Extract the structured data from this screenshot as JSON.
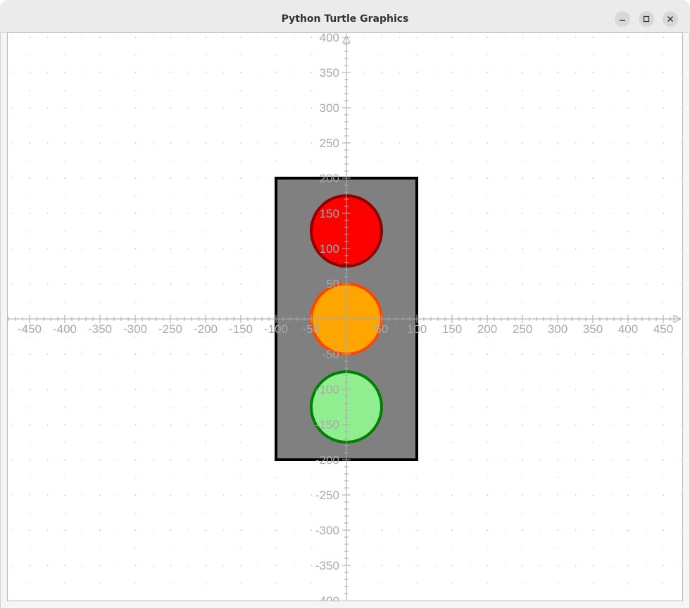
{
  "window": {
    "title": "Python Turtle Graphics"
  },
  "axes": {
    "x_ticks": [
      -450,
      -400,
      -350,
      -300,
      -250,
      -200,
      -150,
      -100,
      -50,
      50,
      100,
      150,
      200,
      250,
      300,
      350,
      400,
      450
    ],
    "y_ticks": [
      400,
      350,
      300,
      250,
      200,
      150,
      100,
      50,
      -50,
      -100,
      -150,
      -200,
      -250,
      -300,
      -350,
      -400
    ],
    "grid": "dotted",
    "color": "#a9a9a9"
  },
  "drawing": {
    "housing": {
      "x_range": [
        -100,
        100
      ],
      "y_range": [
        -200,
        200
      ],
      "fill": "#808080",
      "stroke": "#000000"
    },
    "lights": [
      {
        "name": "red",
        "center": [
          0,
          125
        ],
        "radius": 50,
        "fill": "#ff0000",
        "stroke": "#8b0000"
      },
      {
        "name": "orange",
        "center": [
          0,
          0
        ],
        "radius": 50,
        "fill": "#ffa500",
        "stroke": "#ff4500"
      },
      {
        "name": "green",
        "center": [
          0,
          -125
        ],
        "radius": 50,
        "fill": "#90ee90",
        "stroke": "#008000"
      }
    ]
  }
}
